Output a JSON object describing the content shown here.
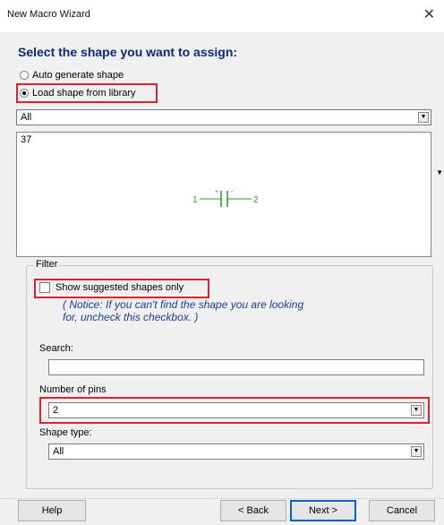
{
  "window": {
    "title": "New Macro Wizard",
    "close_glyph": "✕"
  },
  "heading": "Select the shape you want to assign:",
  "options": {
    "auto": "Auto generate shape",
    "load": "Load shape from library",
    "selected": "load"
  },
  "library_select": {
    "value": "All"
  },
  "shape_preview": {
    "count": "37",
    "symbol": {
      "pin1": "1",
      "pin2": "2",
      "plus": "+",
      "minus": "-",
      "name": "capacitor-symbol",
      "color": "#1f9e2a"
    }
  },
  "filter": {
    "group_label": "Filter",
    "suggested_label": "Show suggested shapes only",
    "suggested_checked": false,
    "notice_line1": "( Notice: If you can't find the shape you are looking",
    "notice_line2": "for, uncheck this checkbox. )",
    "search_label": "Search:",
    "search_value": "",
    "pins_label": "Number of pins",
    "pins_value": "2",
    "shape_type_label": "Shape type:",
    "shape_type_value": "All"
  },
  "buttons": {
    "help": "Help",
    "back": "< Back",
    "next": "Next >",
    "cancel": "Cancel"
  },
  "colors": {
    "highlight": "#e0202a",
    "heading": "#0a2c78",
    "notice": "#1c3c9c",
    "default_button_border": "#0a5fcd"
  }
}
